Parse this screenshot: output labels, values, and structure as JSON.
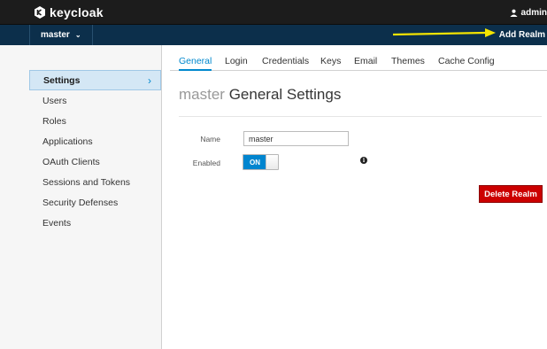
{
  "header": {
    "logo_text": "keycloak",
    "user_label": "admin"
  },
  "realm_bar": {
    "selected_realm": "master",
    "add_realm_label": "Add Realm"
  },
  "sidebar": {
    "items": [
      {
        "label": "Settings",
        "active": true
      },
      {
        "label": "Users"
      },
      {
        "label": "Roles"
      },
      {
        "label": "Applications"
      },
      {
        "label": "OAuth Clients"
      },
      {
        "label": "Sessions and Tokens"
      },
      {
        "label": "Security Defenses"
      },
      {
        "label": "Events"
      }
    ]
  },
  "tabs": [
    {
      "label": "General",
      "active": true
    },
    {
      "label": "Login"
    },
    {
      "label": "Credentials"
    },
    {
      "label": "Keys"
    },
    {
      "label": "Email"
    },
    {
      "label": "Themes"
    },
    {
      "label": "Cache Config"
    }
  ],
  "page": {
    "title_realm": "master",
    "title_rest": "General Settings"
  },
  "form": {
    "name_label": "Name",
    "name_value": "master",
    "enabled_label": "Enabled",
    "enabled_state": "ON",
    "info_glyph": "i",
    "delete_label": "Delete Realm"
  },
  "colors": {
    "accent": "#0088ce",
    "danger": "#cc0000",
    "header_bg": "#1c1c1c",
    "realm_bar_bg": "#0c2f4b",
    "annotation_arrow": "#f5e400"
  }
}
